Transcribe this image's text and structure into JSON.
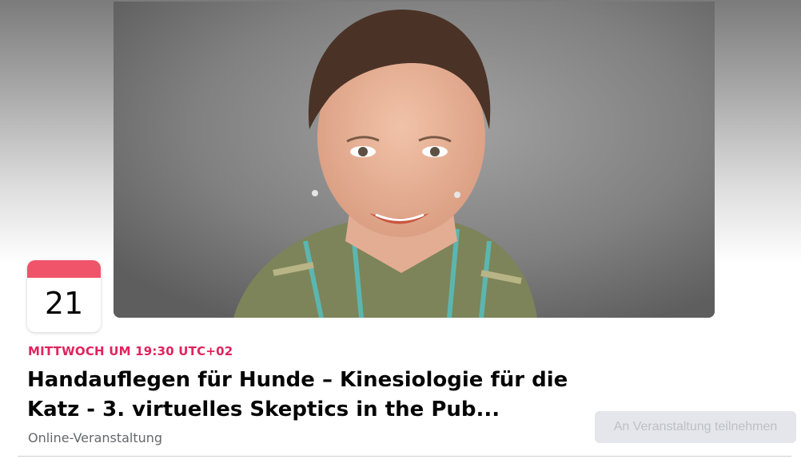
{
  "event": {
    "day": "21",
    "time": "MITTWOCH UM 19:30 UTC+02",
    "title": "Handauflegen für Hunde – Kinesiologie für die Katz - 3. virtuelles Skeptics in the Pub...",
    "location": "Online-Veranstaltung",
    "join_label": "An Veranstaltung teilnehmen"
  },
  "colors": {
    "accent": "#e0245e",
    "calendar_top": "#f0546a",
    "button_bg": "#e4e6eb",
    "button_text": "#bcc0c4",
    "secondary_text": "#65676b"
  },
  "cover": {
    "description_icon": "portrait-photo"
  }
}
